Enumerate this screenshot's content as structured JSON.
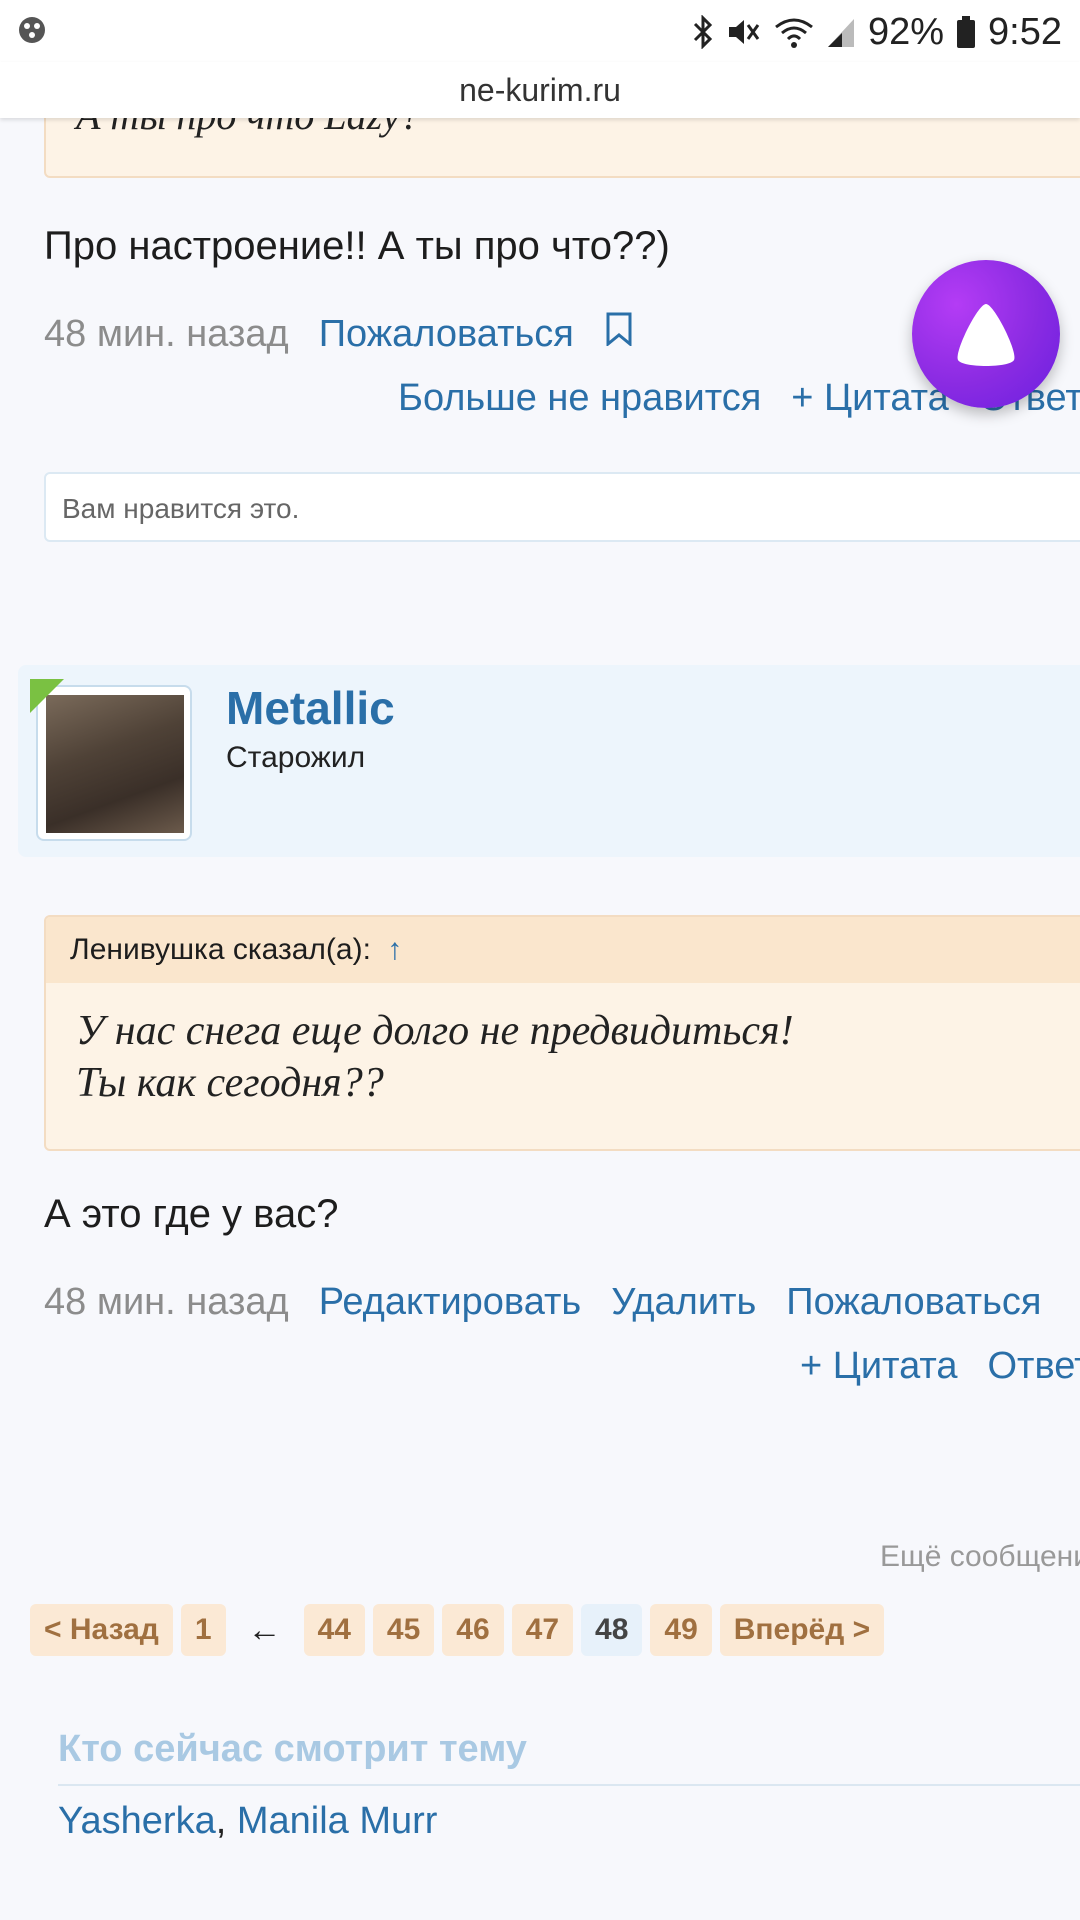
{
  "status": {
    "battery": "92%",
    "time": "9:52"
  },
  "browser": {
    "url": "ne-kurim.ru"
  },
  "top_quote": {
    "text": "А ты про что Lazy?"
  },
  "post1": {
    "text": "Про настроение!! А ты про что??)",
    "time": "48 мин. назад",
    "report": "Пожаловаться",
    "unlike": "Больше не нравится",
    "quote": "+ Цитата",
    "reply": "Ответить",
    "like_note": "Вам нравится это."
  },
  "post2": {
    "username": "Metallic",
    "usertitle": "Старожил",
    "quote_author": "Ленивушка сказал(а):",
    "quote_arrow": "↑",
    "quote_line1": "У нас снега еще долго не предвидиться!",
    "quote_line2": "Ты как сегодня??",
    "text": "А это где у вас?",
    "time": "48 мин. назад",
    "edit": "Редактировать",
    "delete": "Удалить",
    "report": "Пожаловаться",
    "quote": "+ Цитата",
    "reply": "Ответить"
  },
  "more_messages": "Ещё сообщения",
  "pagination": {
    "prev": "< Назад",
    "first": "1",
    "skip": "←",
    "pages": [
      "44",
      "45",
      "46",
      "47",
      "48",
      "49"
    ],
    "current": "48",
    "next": "Вперёд >"
  },
  "watching": {
    "title": "Кто сейчас смотрит тему",
    "user1": "Yasherka",
    "separator": ",",
    "user2": "Manila Murr"
  }
}
